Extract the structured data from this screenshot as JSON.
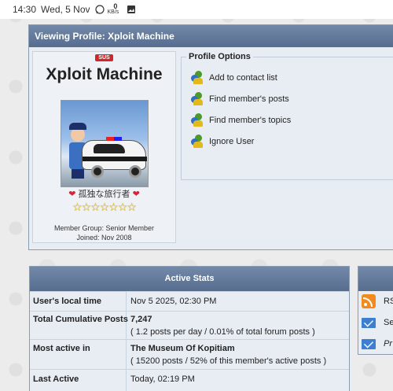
{
  "status_bar": {
    "time": "14:30",
    "date": "Wed, 5 Nov",
    "speed_value": "0",
    "speed_unit": "KB/s",
    "icons": [
      "whatsapp-icon",
      "image-icon"
    ]
  },
  "profile": {
    "title": "Viewing Profile: Xploit Machine",
    "badge": "SUS",
    "name": "Xploit Machine",
    "nickname": "孤独な旅行者",
    "stars": "☆☆☆☆☆☆☆",
    "member_group": "Member Group: Senior Member",
    "joined": "Joined: Nov 2008"
  },
  "profile_options": {
    "title": "Profile Options",
    "items": [
      {
        "label": "Add to contact list",
        "icon": "members-icon"
      },
      {
        "label": "Find member's posts",
        "icon": "members-icon"
      },
      {
        "label": "Find member's topics",
        "icon": "members-icon"
      },
      {
        "label": "Ignore User",
        "icon": "members-icon"
      }
    ]
  },
  "active_stats": {
    "title": "Active Stats",
    "rows": [
      {
        "key": "User's local time",
        "value": "Nov 5 2025, 02:30 PM",
        "sub": ""
      },
      {
        "key": "Total Cumulative Posts",
        "value": "7,247",
        "sub": "( 1.2 posts per day / 0.01% of total forum posts )"
      },
      {
        "key": "Most active in",
        "value": "The Museum Of Kopitiam",
        "sub": "( 15200 posts / 52% of this member's active posts )"
      },
      {
        "key": "Last Active",
        "value": "Today, 02:19 PM",
        "sub": ""
      }
    ]
  },
  "side_panel": {
    "items": [
      {
        "label": "RS",
        "icon": "rss-icon"
      },
      {
        "label": "Se",
        "icon": "mail-icon"
      },
      {
        "label": "Pr",
        "icon": "mail-icon"
      }
    ]
  },
  "colors": {
    "header_bar": "#566d8f",
    "panel_bg": "#e8edf4",
    "badge_red": "#d0272d",
    "star_gold": "#f3c21a"
  }
}
